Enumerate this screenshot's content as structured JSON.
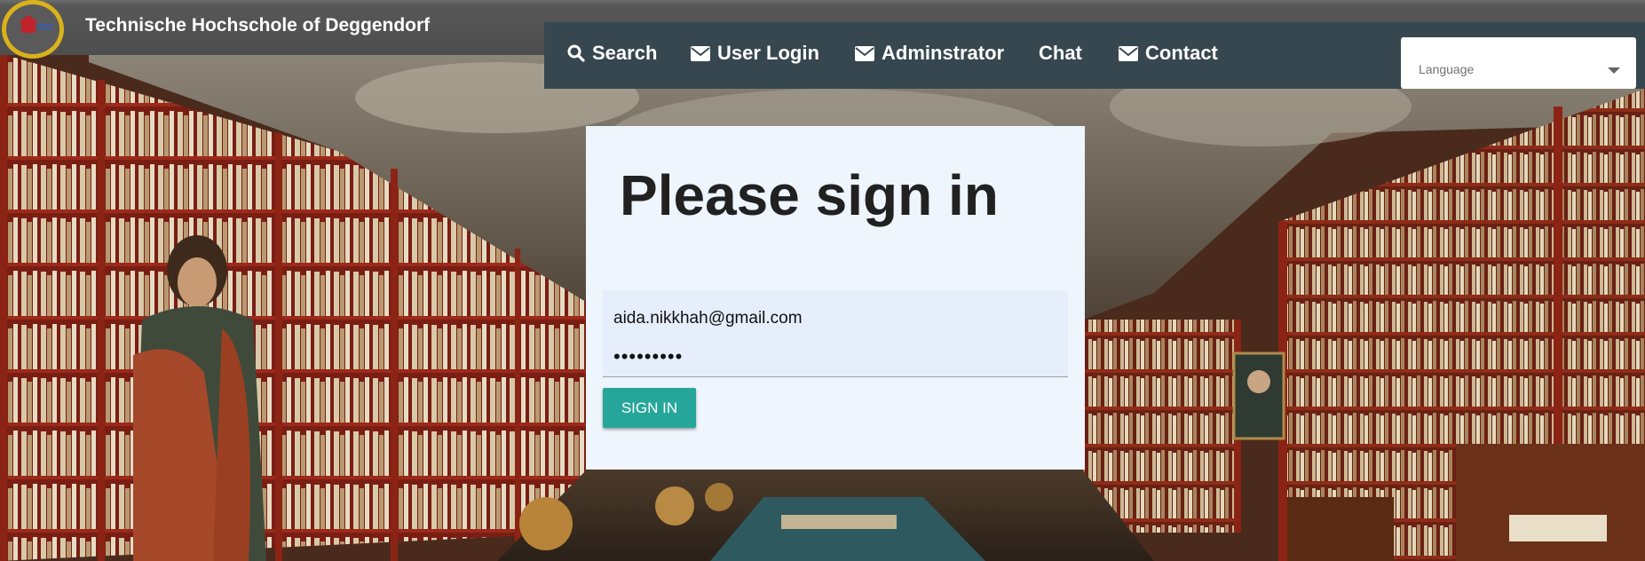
{
  "header": {
    "title": "Technische Hochschole of Deggendorf",
    "logo_icon": "university-logo-icon"
  },
  "nav": {
    "items": [
      {
        "label": "Search",
        "icon": "search-icon"
      },
      {
        "label": "User Login",
        "icon": "envelope-icon"
      },
      {
        "label": "Adminstrator",
        "icon": "envelope-icon"
      },
      {
        "label": "Chat",
        "icon": ""
      },
      {
        "label": "Contact",
        "icon": "envelope-icon"
      }
    ],
    "background": "#37474f"
  },
  "language_select": {
    "placeholder": "Language"
  },
  "login": {
    "title": "Please sign in",
    "email_value": "aida.nikkhah@gmail.com",
    "password_value": "•••••••••",
    "button_label": "SIGN IN",
    "button_color": "#26a69a",
    "card_color": "#eef5fd"
  }
}
